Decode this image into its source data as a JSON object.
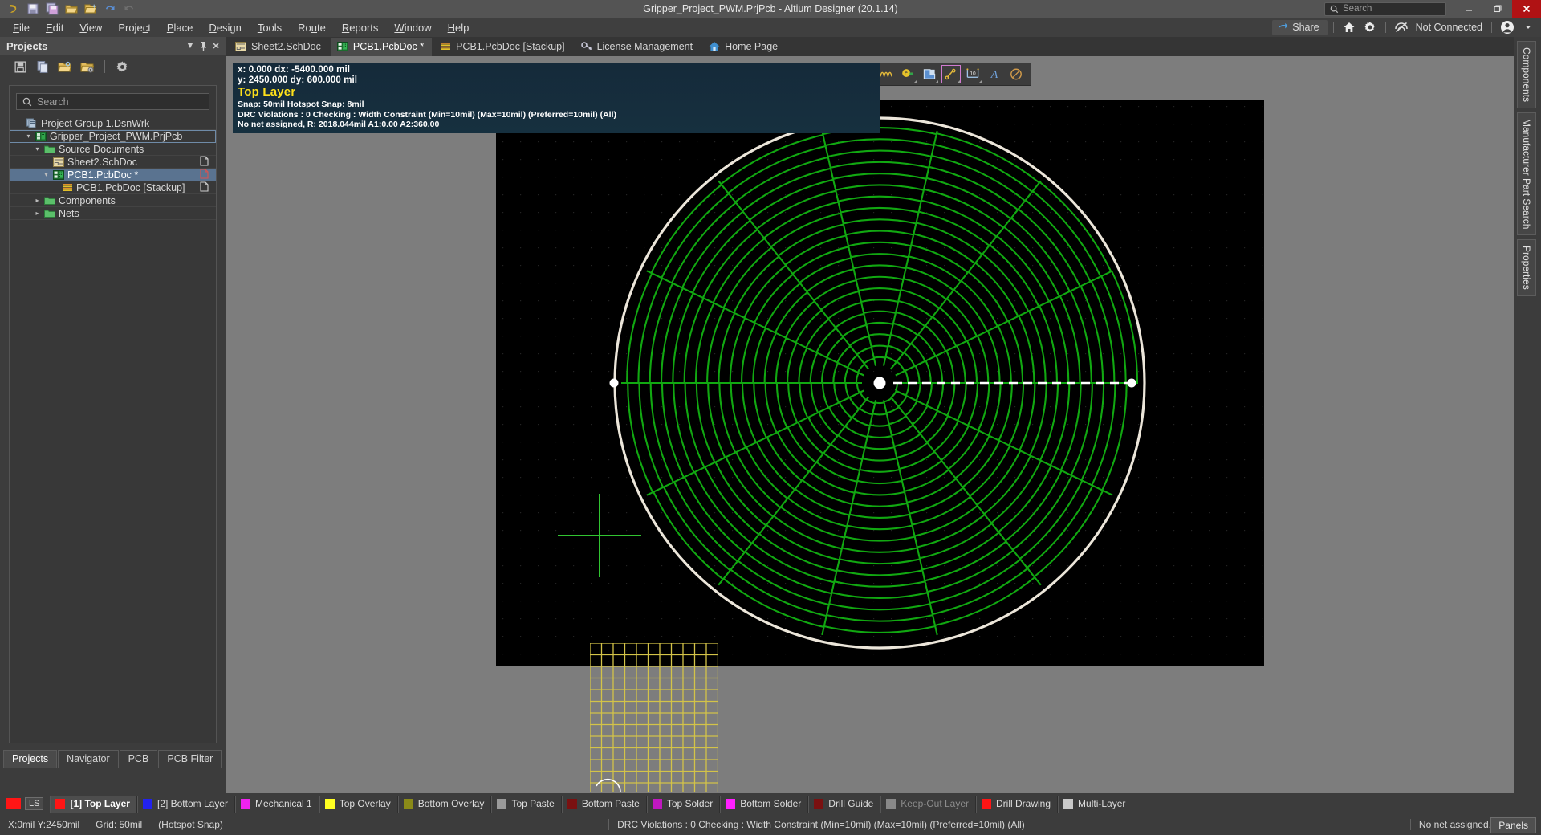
{
  "titlebar": {
    "title": "Gripper_Project_PWM.PrjPcb - Altium Designer (20.1.14)",
    "search_placeholder": "Search",
    "minimize": "—",
    "maximize": "❐",
    "close": "✕",
    "quick_icons": [
      "altium-logo-icon",
      "save-icon",
      "save-all-icon",
      "open-folder-icon",
      "open-project-icon",
      "undo-icon",
      "redo-icon"
    ]
  },
  "menubar": {
    "items": [
      {
        "pre": "",
        "u": "F",
        "post": "ile"
      },
      {
        "pre": "",
        "u": "E",
        "post": "dit"
      },
      {
        "pre": "",
        "u": "V",
        "post": "iew"
      },
      {
        "pre": "Proje",
        "u": "c",
        "post": "t"
      },
      {
        "pre": "",
        "u": "P",
        "post": "lace"
      },
      {
        "pre": "",
        "u": "D",
        "post": "esign"
      },
      {
        "pre": "",
        "u": "T",
        "post": "ools"
      },
      {
        "pre": "Ro",
        "u": "u",
        "post": "te"
      },
      {
        "pre": "",
        "u": "R",
        "post": "eports"
      },
      {
        "pre": "",
        "u": "W",
        "post": "indow"
      },
      {
        "pre": "",
        "u": "H",
        "post": "elp"
      }
    ],
    "share_label": "Share",
    "connection_status": "Not Connected"
  },
  "projects_panel": {
    "title": "Projects",
    "search_placeholder": "Search",
    "toolbar_icons": [
      "save-icon",
      "copy-icon",
      "open-project-folder-icon",
      "project-options-folder-icon",
      "settings-gear-icon"
    ],
    "tree": [
      {
        "label": "Project Group 1.DsnWrk",
        "indent": 0,
        "twisty": "",
        "icon": "workspace-icon",
        "selected": false,
        "boxed": false,
        "doc_glyph": false
      },
      {
        "label": "Gripper_Project_PWM.PrjPcb",
        "indent": 1,
        "twisty": "▾",
        "icon": "pcb-project-icon",
        "selected": false,
        "boxed": true,
        "doc_glyph": false
      },
      {
        "label": "Source Documents",
        "indent": 2,
        "twisty": "▾",
        "icon": "folder-icon",
        "selected": false,
        "boxed": false,
        "doc_glyph": false
      },
      {
        "label": "Sheet2.SchDoc",
        "indent": 3,
        "twisty": "",
        "icon": "schematic-doc-icon",
        "selected": false,
        "boxed": false,
        "doc_glyph": true
      },
      {
        "label": "PCB1.PcbDoc *",
        "indent": 3,
        "twisty": "▾",
        "icon": "pcb-doc-icon",
        "selected": true,
        "boxed": false,
        "doc_glyph": true,
        "doc_glyph_color": "#d9534f"
      },
      {
        "label": "PCB1.PcbDoc [Stackup]",
        "indent": 4,
        "twisty": "",
        "icon": "stackup-icon",
        "selected": false,
        "boxed": false,
        "doc_glyph": true
      },
      {
        "label": "Components",
        "indent": 2,
        "twisty": "▸",
        "icon": "folder-icon",
        "selected": false,
        "boxed": false,
        "doc_glyph": false
      },
      {
        "label": "Nets",
        "indent": 2,
        "twisty": "▸",
        "icon": "folder-icon",
        "selected": false,
        "boxed": false,
        "doc_glyph": false
      }
    ],
    "bottom_tabs": [
      {
        "label": "Projects",
        "active": true
      },
      {
        "label": "Navigator",
        "active": false
      },
      {
        "label": "PCB",
        "active": false
      },
      {
        "label": "PCB Filter",
        "active": false
      }
    ]
  },
  "document_tabs": [
    {
      "label": "Sheet2.SchDoc",
      "icon": "schematic-doc-icon",
      "active": false
    },
    {
      "label": "PCB1.PcbDoc *",
      "icon": "pcb-doc-icon",
      "active": true
    },
    {
      "label": "PCB1.PcbDoc [Stackup]",
      "icon": "stackup-icon",
      "active": false
    },
    {
      "label": "License Management",
      "icon": "key-icon",
      "active": false
    },
    {
      "label": "Home Page",
      "icon": "home-icon",
      "active": false
    }
  ],
  "hud": {
    "line1": "x:     0.000      dx: -5400.000  mil",
    "line2": "y: 2450.000   dy:   600.000  mil",
    "layer": "Top Layer",
    "snap": "Snap: 50mil Hotspot Snap: 8mil",
    "drc": "DRC Violations : 0 Checking : Width Constraint (Min=10mil) (Max=10mil) (Preferred=10mil) (All)",
    "net": "No net assigned,    R: 2018.044mil    A1:0.00    A2:360.00"
  },
  "pcb_toolbar": {
    "icons": [
      {
        "name": "filter-icon",
        "caret": false,
        "boxed": false
      },
      {
        "name": "magnet-snap-icon",
        "caret": false,
        "boxed": false
      },
      {
        "name": "place-crosshair-icon",
        "caret": true,
        "boxed": false
      },
      {
        "name": "place-rectangle-icon",
        "caret": true,
        "boxed": false
      },
      {
        "name": "layer-stack-icon",
        "caret": false,
        "boxed": false
      },
      {
        "name": "separator",
        "caret": false,
        "boxed": false
      },
      {
        "name": "place-component-icon",
        "caret": false,
        "boxed": false
      },
      {
        "name": "route-track-icon",
        "caret": true,
        "boxed": false
      },
      {
        "name": "interactive-length-tuning-icon",
        "caret": false,
        "boxed": false
      },
      {
        "name": "place-via-icon",
        "caret": true,
        "boxed": false
      },
      {
        "name": "place-polygon-pour-icon",
        "caret": true,
        "boxed": false
      },
      {
        "name": "place-pad-icon",
        "caret": true,
        "boxed": true
      },
      {
        "name": "place-dimension-icon",
        "caret": true,
        "boxed": false
      },
      {
        "name": "place-string-icon",
        "caret": false,
        "boxed": false
      },
      {
        "name": "place-arc-icon",
        "caret": false,
        "boxed": false
      }
    ]
  },
  "canvas": {
    "description": "PCB spiral coil artwork on black board outline",
    "board_outline_color": "#e6e0d4",
    "trace_color": "#11a811",
    "crosshair_color": "#31c431",
    "grid_color": "#d3c348"
  },
  "layer_bar": {
    "ls_label": "LS",
    "ls_color": "#ff1515",
    "layers": [
      {
        "label": "[1] Top Layer",
        "color": "#ff1515",
        "active": true,
        "disabled": false
      },
      {
        "label": "[2] Bottom Layer",
        "color": "#2222ee",
        "active": false,
        "disabled": false
      },
      {
        "label": "Mechanical 1",
        "color": "#ee22ee",
        "active": false,
        "disabled": false
      },
      {
        "label": "Top Overlay",
        "color": "#ffff22",
        "active": false,
        "disabled": false
      },
      {
        "label": "Bottom Overlay",
        "color": "#8a8a18",
        "active": false,
        "disabled": false
      },
      {
        "label": "Top Paste",
        "color": "#9a9a9a",
        "active": false,
        "disabled": false
      },
      {
        "label": "Bottom Paste",
        "color": "#7a1111",
        "active": false,
        "disabled": false
      },
      {
        "label": "Top Solder",
        "color": "#c018c0",
        "active": false,
        "disabled": false
      },
      {
        "label": "Bottom Solder",
        "color": "#ff1fff",
        "active": false,
        "disabled": false
      },
      {
        "label": "Drill Guide",
        "color": "#7a1111",
        "active": false,
        "disabled": false
      },
      {
        "label": "Keep-Out Layer",
        "color": "#888888",
        "active": false,
        "disabled": true
      },
      {
        "label": "Drill Drawing",
        "color": "#ff1515",
        "active": false,
        "disabled": false
      },
      {
        "label": "Multi-Layer",
        "color": "#c9c9c9",
        "active": false,
        "disabled": false
      }
    ]
  },
  "statusbar": {
    "coords": "X:0mil Y:2450mil",
    "grid": "Grid: 50mil",
    "snap_mode": "(Hotspot Snap)",
    "drc": "DRC Violations : 0 Checking : Width Constraint (Min=10mil) (Max=10mil) (Preferred=10mil) (All)",
    "net": "No net assigned,",
    "radius": "R: 2018",
    "panels_label": "Panels"
  },
  "right_rail": {
    "tabs": [
      "Components",
      "Manufacturer Part Search",
      "Properties"
    ]
  }
}
